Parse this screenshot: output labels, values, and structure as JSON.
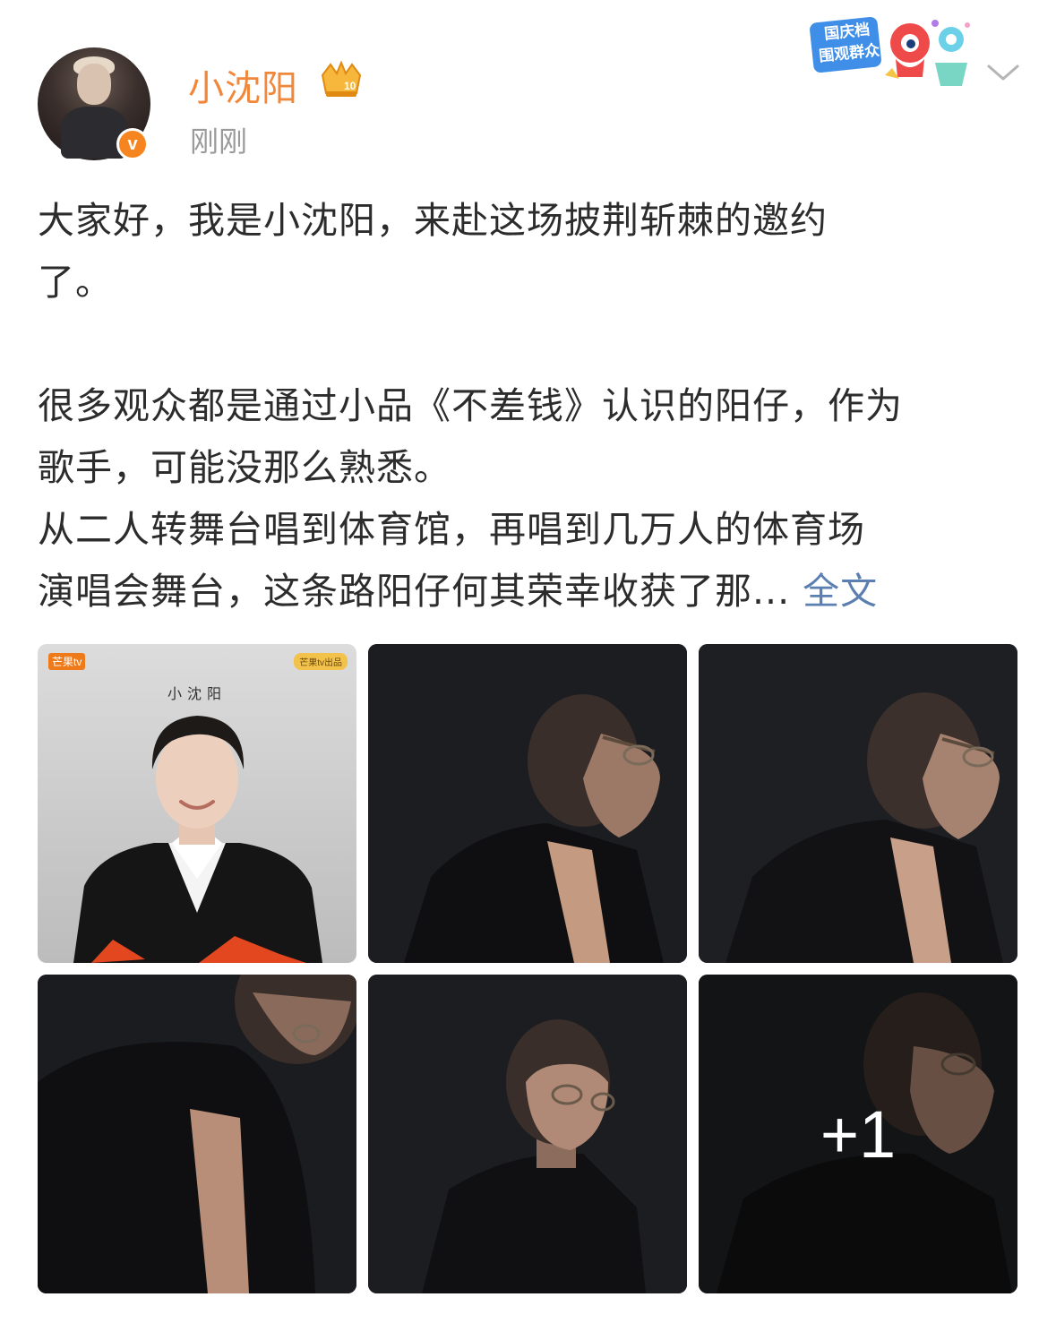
{
  "header": {
    "username": "小沈阳",
    "timestamp": "刚刚",
    "verified_mark": "v",
    "crown_badge_icon": "crown-level-badge-icon",
    "crown_level": "10",
    "promo_banner": {
      "text_line1": "国庆档",
      "text_line2": "围观群众",
      "icon": "promo-mascot-icon"
    },
    "menu_icon": "chevron-down-icon"
  },
  "post": {
    "line1": "大家好，我是小沈阳，来赴这场披荆斩棘的邀约",
    "line2": "了。",
    "line3": "很多观众都是通过小品《不差钱》认识的阳仔，作为",
    "line4": "歌手，可能没那么熟悉。",
    "line5": "从二人转舞台唱到体育馆，再唱到几万人的体育场",
    "line6_prefix": "演唱会舞台，这条路阳仔何其荣幸收获了那...",
    "more_link": "全文"
  },
  "images": {
    "tile1_name": "小沈阳",
    "tile1_logo": "芒果tv",
    "tile1_badge": "芒果tv出品",
    "more_count": "+1"
  },
  "colors": {
    "username": "#f1873b",
    "verified": "#f7851f",
    "link": "#5b7fb0",
    "timestamp": "#9a9a9a"
  }
}
